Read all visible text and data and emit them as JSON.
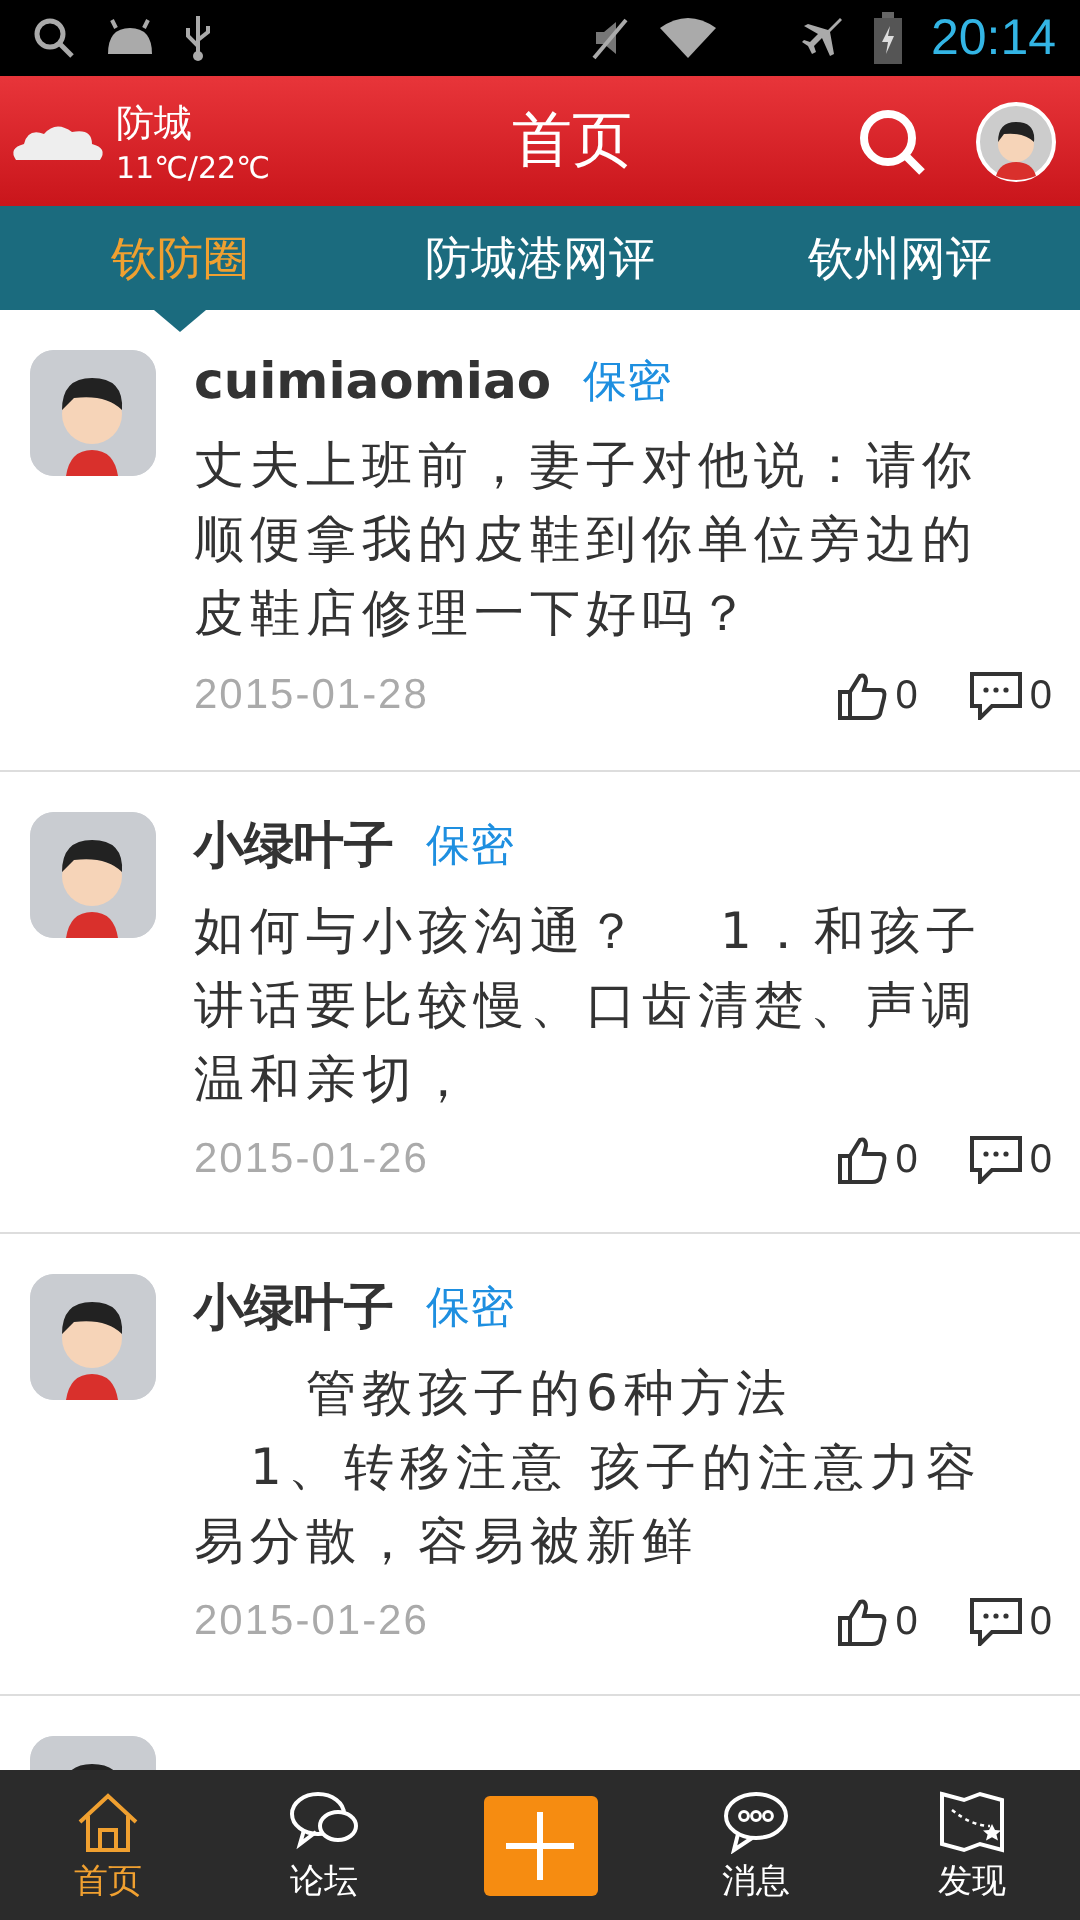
{
  "status_bar": {
    "time": "20:14"
  },
  "header": {
    "city": "防城",
    "temperature": "11℃/22℃",
    "title": "首页"
  },
  "tabs": [
    {
      "label": "钦防圈",
      "selected": true
    },
    {
      "label": "防城港网评",
      "selected": false
    },
    {
      "label": "钦州网评",
      "selected": false
    }
  ],
  "posts": [
    {
      "author": "cuimiaomiao",
      "tag": "保密",
      "text": "丈夫上班前，妻子对他说：请你顺便拿我的皮鞋到你单位旁边的皮鞋店修理一下好吗？",
      "date": "2015-01-28",
      "likes": "0",
      "comments": "0"
    },
    {
      "author": "小绿叶子",
      "tag": "保密",
      "text": "如何与小孩沟通？　 1．和孩子讲话要比较慢、口齿清楚、声调温和亲切，",
      "date": "2015-01-26",
      "likes": "0",
      "comments": "0"
    },
    {
      "author": "小绿叶子",
      "tag": "保密",
      "text": "　　管教孩子的6种方法\n　1、转移注意 孩子的注意力容易分散，容易被新鲜",
      "date": "2015-01-26",
      "likes": "0",
      "comments": "0"
    }
  ],
  "bottom_nav": [
    {
      "kind": "tab",
      "label": "首页",
      "selected": true
    },
    {
      "kind": "tab",
      "label": "论坛",
      "selected": false
    },
    {
      "kind": "add"
    },
    {
      "kind": "tab",
      "label": "消息",
      "selected": false
    },
    {
      "kind": "tab",
      "label": "发现",
      "selected": false
    }
  ]
}
